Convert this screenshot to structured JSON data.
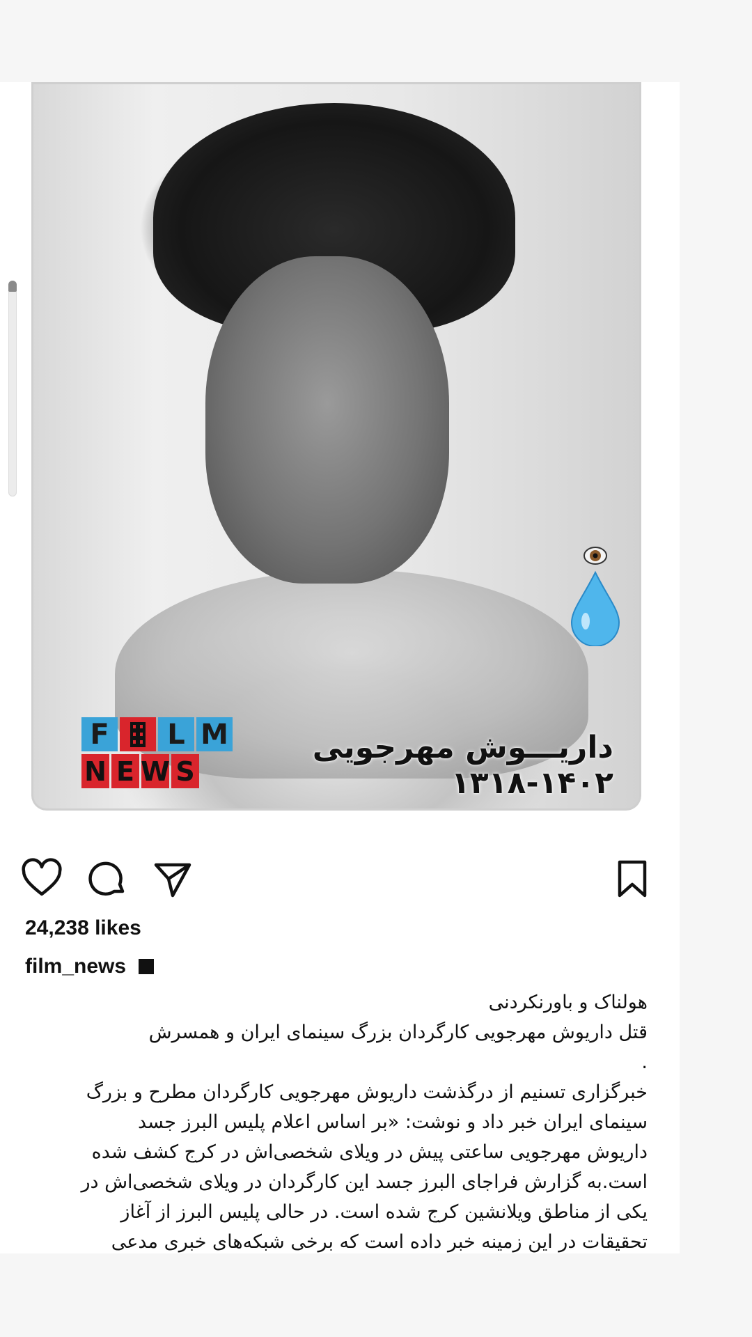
{
  "post": {
    "image_caption_title": "داریـــوش مهرجویی ۱۴۰۲-۱۳۱۸",
    "logo": {
      "top": [
        "F",
        "L",
        "M"
      ],
      "bottom": [
        "N",
        "E",
        "W",
        "S"
      ]
    },
    "likes": "24,238 likes",
    "username": "film_news",
    "caption_lines": [
      "هولناک و باورنکردنی",
      "قتل داریوش مهرجویی کارگردان بزرگ سینمای ایران و همسرش",
      ".",
      "خبرگزاری تسنیم از درگذشت داریوش مهرجویی کارگردان مطرح و بزرگ",
      "سینمای ایران خبر داد و نوشت: «بر اساس اعلام پلیس البرز جسد",
      "داریوش مهرجویی ساعتی پیش در ویلای شخصی‌اش در کرج کشف شده",
      "است.به گزارش فراجای البرز  جسد این کارگردان در ویلای شخصی‌اش در",
      "یکی از مناطق ویلانشین کرج شده است. در حالی پلیس البرز از آغاز",
      "تحقیقات در این زمینه  خبر داده است که برخی شبکه‌های خبری مدعی"
    ]
  },
  "icons": {
    "like": "heart-icon",
    "comment": "comment-bubble-icon",
    "share": "paper-plane-icon",
    "save": "bookmark-icon",
    "tear": "teardrop-eye-icon"
  }
}
